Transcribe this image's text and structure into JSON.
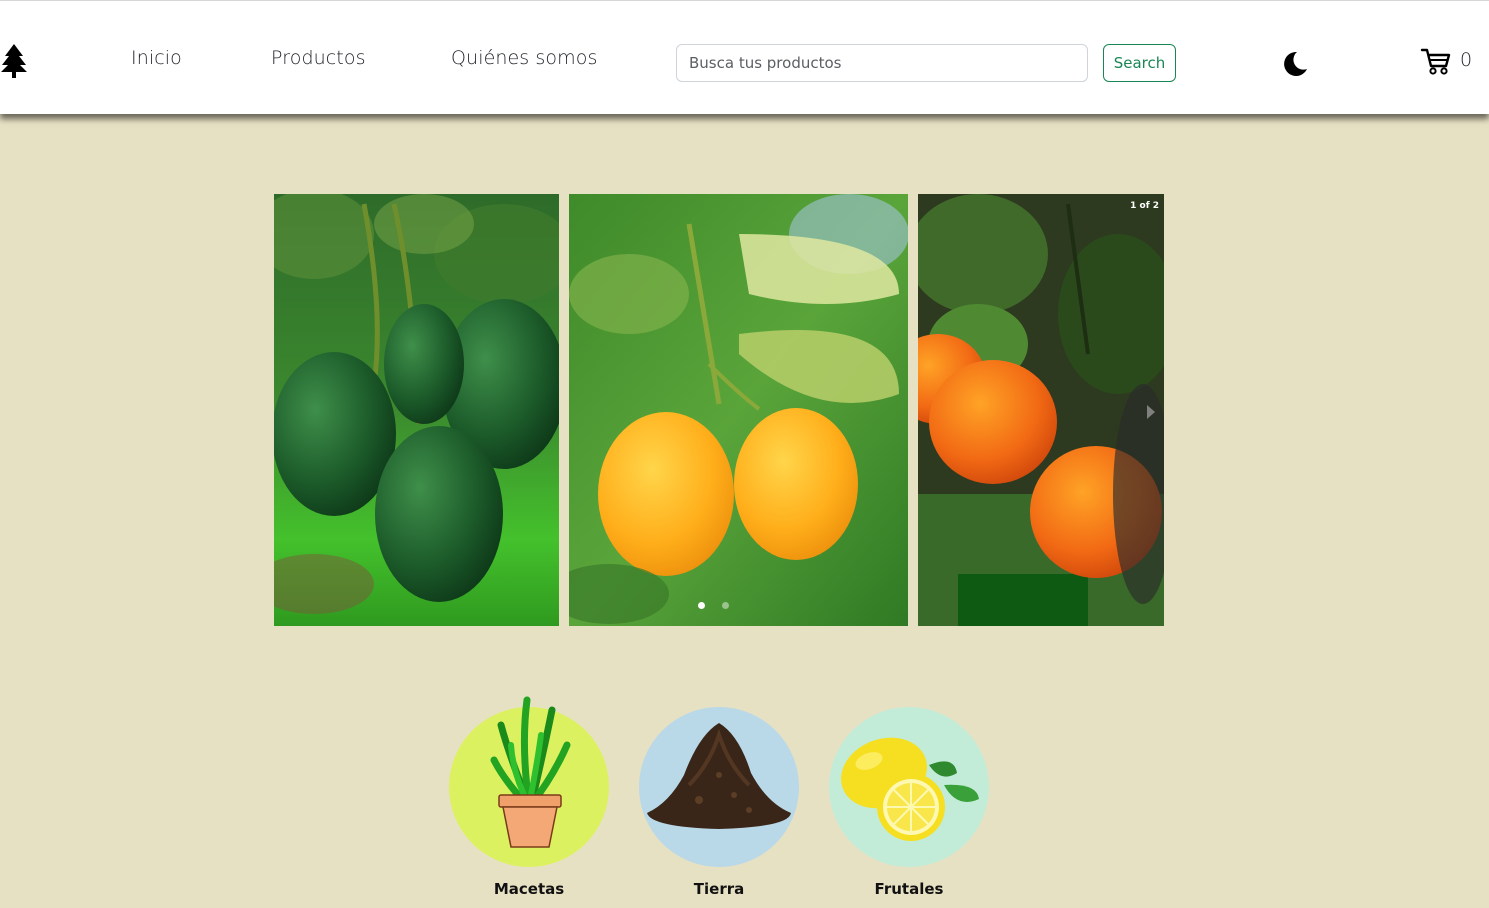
{
  "navbar": {
    "logo_icon": "tree-icon",
    "links": [
      {
        "label": "Inicio"
      },
      {
        "label": "Productos"
      },
      {
        "label": "Quiénes somos"
      }
    ],
    "search": {
      "placeholder": "Busca tus productos",
      "value": "",
      "button_label": "Search"
    },
    "theme_icon": "moon-icon",
    "cart": {
      "icon": "cart-icon",
      "count": "0"
    }
  },
  "carousel": {
    "counter": "1 of 2",
    "slides": [
      {
        "subject": "avocados"
      },
      {
        "subject": "lemons"
      },
      {
        "subject": "oranges"
      }
    ],
    "active_index": 0,
    "dot_count": 2
  },
  "categories": [
    {
      "label": "Macetas",
      "color": "#dcf15f"
    },
    {
      "label": "Tierra",
      "color": "#b9d8e8"
    },
    {
      "label": "Frutales",
      "color": "#c2ecd7"
    }
  ],
  "colors": {
    "page_background": "#e7e1c4",
    "accent_green": "#198754"
  }
}
